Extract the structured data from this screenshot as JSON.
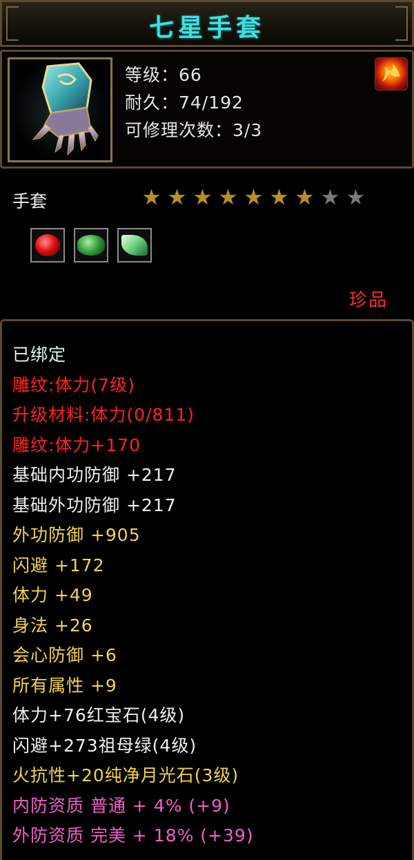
{
  "title": "七星手套",
  "header": {
    "level": "等级：66",
    "durability": "耐久：74/192",
    "repairs": "可修理次数：3/3"
  },
  "item_type": "手套",
  "stars": {
    "filled": 7,
    "total": 9
  },
  "gems": [
    "ruby-gem-icon",
    "emerald-gem-icon",
    "moonstone-gem-icon"
  ],
  "rarity": "珍品",
  "details": {
    "bound": "已绑定",
    "engrave_attr": "雕纹:体力(7级)",
    "upgrade_material": "升级材料:体力(0/811)",
    "engrave_bonus": "雕纹:体力+170",
    "base_inner_def": "基础内功防御 +217",
    "base_outer_def": "基础外功防御 +217",
    "outer_def": "外功防御 +905",
    "dodge": "闪避 +172",
    "stamina": "体力 +49",
    "agility": "身法 +26",
    "crit_def": "会心防御 +6",
    "all_attr": "所有属性 +9",
    "gem1": "体力+76红宝石(4级)",
    "gem2": "闪避+273祖母绿(4级)",
    "gem3": "火抗性+20纯净月光石(3级)",
    "inner_quality": "内防资质 普通 + 4% (+9)",
    "outer_quality": "外防资质 完美 + 18% (+39)"
  },
  "colors": {
    "title": "#3fe0e0",
    "red": "#ff2222",
    "gold": "#f2d54a",
    "pink": "#f060c8",
    "star_on": "#b8902a",
    "star_off": "#7a7a7a"
  }
}
